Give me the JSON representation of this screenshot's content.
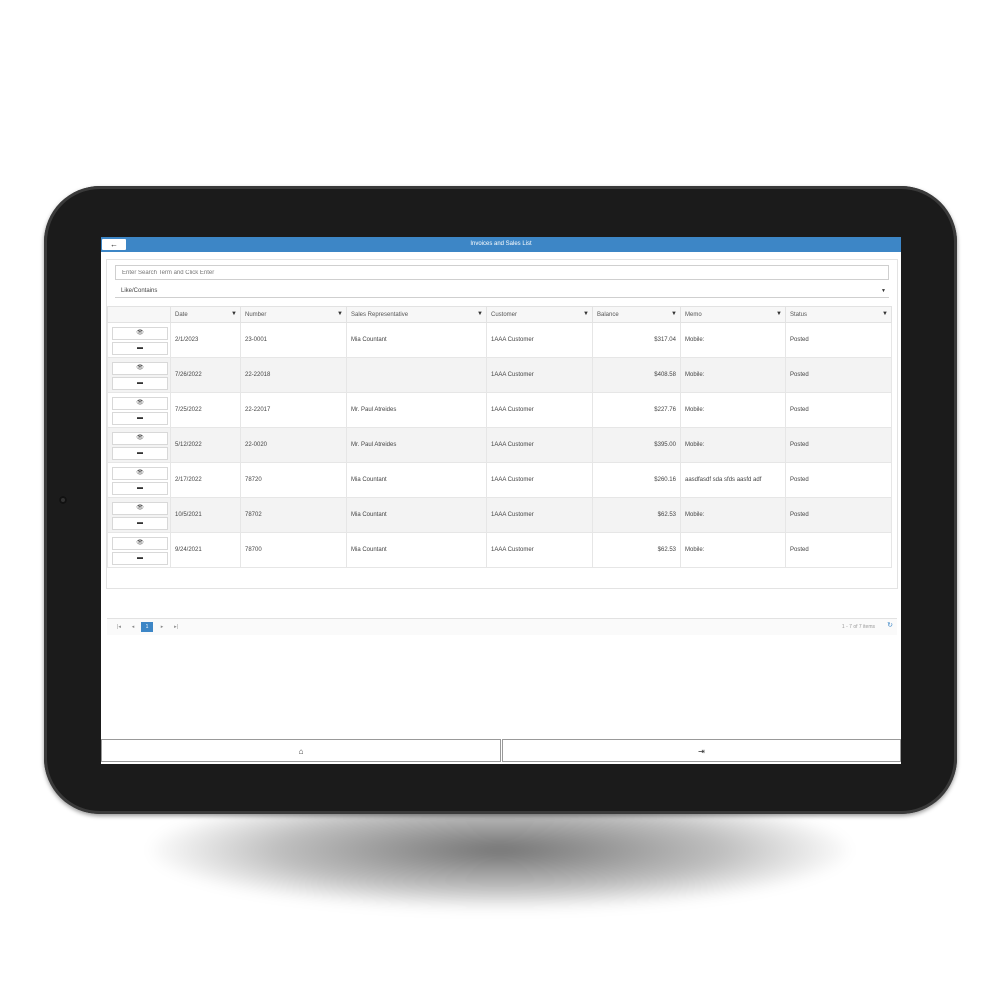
{
  "app": {
    "title": "Invoices and Sales List"
  },
  "icons": {
    "back": "←",
    "view": "👁",
    "edit": "▬",
    "filter": "▼",
    "home": "⌂",
    "logout": "⇥",
    "refresh": "↻"
  },
  "search": {
    "placeholder": "Enter Search Term and Click Enter",
    "mode": "Like/Contains"
  },
  "columns": [
    "Date",
    "Number",
    "Sales Representative",
    "Customer",
    "Balance",
    "Memo",
    "Status"
  ],
  "rows": [
    {
      "date": "2/1/2023",
      "number": "23-0001",
      "rep": "Mia Countant",
      "customer": "1AAA Customer",
      "balance": "$317.04",
      "memo": "Mobile:",
      "status": "Posted"
    },
    {
      "date": "7/26/2022",
      "number": "22-22018",
      "rep": "",
      "customer": "1AAA Customer",
      "balance": "$408.58",
      "memo": "Mobile:",
      "status": "Posted"
    },
    {
      "date": "7/25/2022",
      "number": "22-22017",
      "rep": "Mr. Paul Atreides",
      "customer": "1AAA Customer",
      "balance": "$227.76",
      "memo": "Mobile:",
      "status": "Posted"
    },
    {
      "date": "5/12/2022",
      "number": "22-0020",
      "rep": "Mr. Paul Atreides",
      "customer": "1AAA Customer",
      "balance": "$395.00",
      "memo": "Mobile:",
      "status": "Posted"
    },
    {
      "date": "2/17/2022",
      "number": "78720",
      "rep": "Mia Countant",
      "customer": "1AAA Customer",
      "balance": "$260.16",
      "memo": "aasdfasdf sda sfds aasfd adf",
      "status": "Posted"
    },
    {
      "date": "10/5/2021",
      "number": "78702",
      "rep": "Mia Countant",
      "customer": "1AAA Customer",
      "balance": "$62.53",
      "memo": "Mobile:",
      "status": "Posted"
    },
    {
      "date": "9/24/2021",
      "number": "78700",
      "rep": "Mia Countant",
      "customer": "1AAA Customer",
      "balance": "$62.53",
      "memo": "Mobile:",
      "status": "Posted"
    }
  ],
  "pager": {
    "first": "|◂",
    "prev": "◂",
    "page": "1",
    "next": "▸",
    "last": "▸|",
    "info": "1 - 7 of 7 items"
  }
}
